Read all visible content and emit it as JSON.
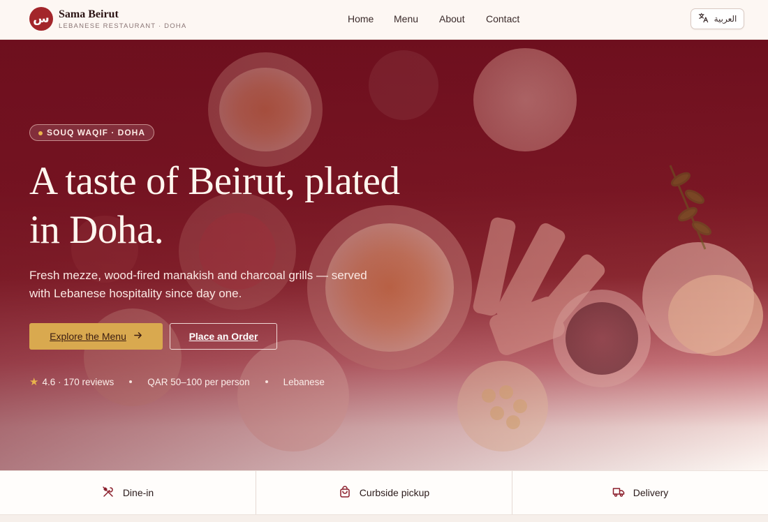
{
  "brand": {
    "logo_glyph": "س",
    "name": "Sama Beirut",
    "tagline": "LEBANESE RESTAURANT · DOHA",
    "accent_color": "#a3262b"
  },
  "nav": {
    "items": [
      {
        "label": "Home"
      },
      {
        "label": "Menu"
      },
      {
        "label": "About"
      },
      {
        "label": "Contact"
      }
    ]
  },
  "language_toggle": {
    "label": "العربية",
    "icon": "translate-icon"
  },
  "hero": {
    "badge": "SOUQ WAQIF · DOHA",
    "headline_line1": "A taste of Beirut, plated",
    "headline_line2": "in Doha.",
    "subtext_line1": "Fresh mezze, wood-fired manakish and charcoal grills — served",
    "subtext_line2": "with Lebanese hospitality since day one.",
    "primary_cta": "Explore the Menu",
    "primary_cta_icon": "arrow-right-icon",
    "secondary_cta": "Place an Order",
    "meta": {
      "rating": "4.6 · 170 reviews",
      "price": "QAR 50–100 per person",
      "cuisine": "Lebanese"
    },
    "colors": {
      "overlay": "#6e0f1e",
      "cta_gold": "#d9a94f",
      "star": "#e9b44c"
    }
  },
  "services": [
    {
      "label": "Dine-in",
      "icon": "utensils-icon"
    },
    {
      "label": "Curbside pickup",
      "icon": "shopping-bag-icon"
    },
    {
      "label": "Delivery",
      "icon": "truck-icon"
    }
  ]
}
